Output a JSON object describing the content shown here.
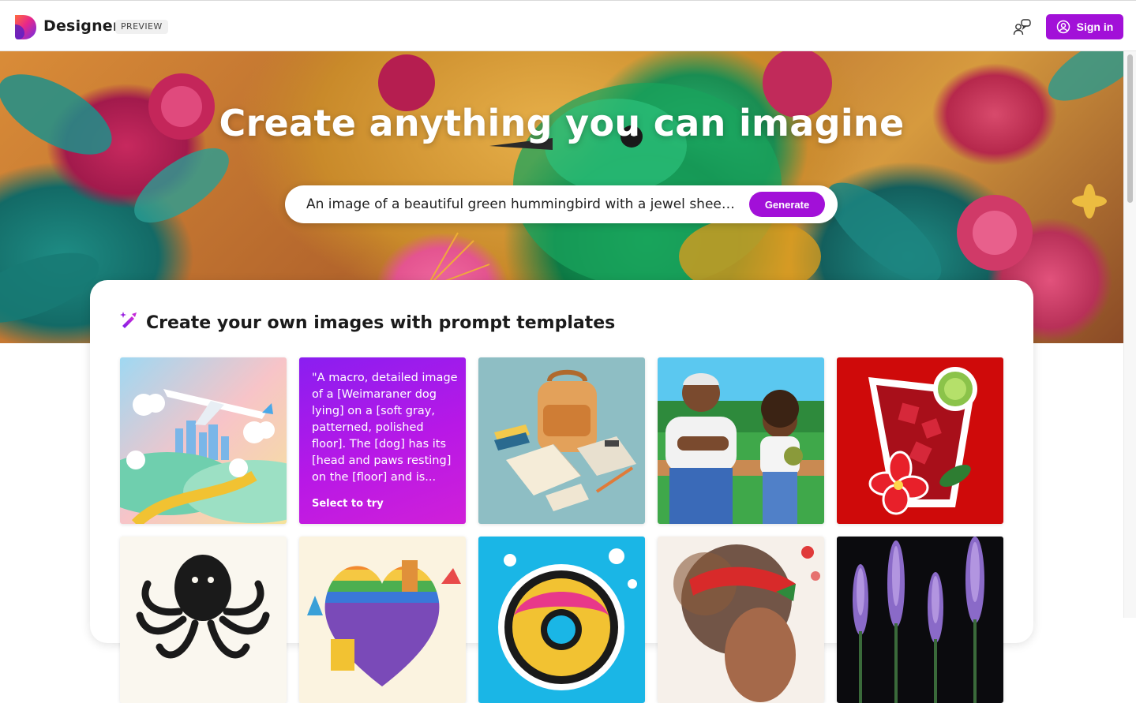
{
  "header": {
    "brand": "Designer",
    "badge": "PREVIEW",
    "signin_label": "Sign in",
    "colors": {
      "accent": "#a210d8"
    }
  },
  "hero": {
    "title": "Create anything you can imagine",
    "prompt_value": "An image of a beautiful green hummingbird with a jewel sheen sit...",
    "generate_label": "Generate"
  },
  "templates": {
    "title": "Create your own images with prompt templates",
    "text_tile": {
      "quote": "\"A macro, detailed image of a [Weimaraner dog lying] on a [soft gray, patterned, polished floor]. The [dog] has its [head and paws resting] on the [floor] and is...",
      "cta": "Select to try"
    },
    "tiles": [
      "airplane-city-tile",
      "prompt-text-tile",
      "backpack-supplies-tile",
      "baseball-grandpa-girl-tile",
      "red-drink-hibiscus-tile",
      "octopus-ink-tile",
      "rainbow-heart-tile",
      "donut-splash-tile",
      "watercolor-woman-tile",
      "lupine-flowers-tile"
    ]
  }
}
